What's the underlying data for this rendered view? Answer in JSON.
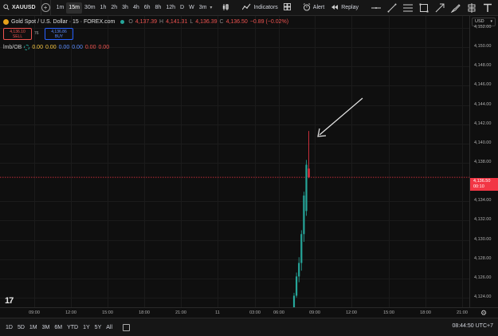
{
  "toolbar": {
    "symbol": "XAUUSD",
    "timeframes": [
      "1m",
      "15m",
      "30m",
      "1h",
      "2h",
      "3h",
      "4h",
      "6h",
      "8h",
      "12h",
      "D",
      "W",
      "3m"
    ],
    "active_timeframe": "15m",
    "indicators_label": "Indicators",
    "alert_label": "Alert",
    "replay_label": "Replay",
    "drawing_tools": [
      "horizontal-line-icon",
      "trend-line-icon",
      "fib-retracement-icon",
      "rectangle-icon",
      "arrow-tool-icon",
      "brush-icon",
      "long-position-icon",
      "text-icon",
      "measure-icon"
    ]
  },
  "legend": {
    "title": "Gold Spot / U.S. Dollar · 15 · FOREX.com",
    "o_label": "O",
    "o": "4,137.39",
    "h_label": "H",
    "h": "4,141.31",
    "l_label": "L",
    "l": "4,136.39",
    "c_label": "C",
    "c": "4,136.50",
    "change": "−0.89 (−0.02%)"
  },
  "trade": {
    "sell_price": "4,136.10",
    "sell_label": "SELL",
    "spread": "76",
    "buy_price": "4,136.86",
    "buy_label": "BUY"
  },
  "indicator": {
    "name": "lmb/OB",
    "values": [
      "0.00",
      "0.00",
      "0.00",
      "0.00",
      "0.00",
      "0.00"
    ],
    "value_colors": [
      "#f5c542",
      "#f5c542",
      "#5b8cff",
      "#5b8cff",
      "#ef5350",
      "#ef5350"
    ]
  },
  "price_axis": {
    "currency": "USD",
    "labels": [
      "4,152.00",
      "4,150.00",
      "4,148.00",
      "4,146.00",
      "4,144.00",
      "4,142.00",
      "4,140.00",
      "4,138.00",
      "4,134.00",
      "4,132.00",
      "4,130.00",
      "4,128.00",
      "4,126.00",
      "4,124.00"
    ],
    "current_price": "4,136.50",
    "countdown": "00:10"
  },
  "time_axis": {
    "labels": [
      "09:00",
      "12:00",
      "15:00",
      "18:00",
      "21:00",
      "11",
      "03:00",
      "06:00",
      "09:00",
      "12:00",
      "15:00",
      "18:00",
      "21:00"
    ]
  },
  "bottom_bar": {
    "ranges": [
      "1D",
      "5D",
      "1M",
      "3M",
      "6M",
      "YTD",
      "1Y",
      "5Y",
      "All"
    ],
    "clock": "08:44:50 UTC+7"
  },
  "colors": {
    "up": "#26a69a",
    "down": "#f23645",
    "background": "#0f0f0f",
    "price_line": "#f23645"
  },
  "chart_data": {
    "type": "candlestick",
    "timeframe": "15",
    "ylim": [
      4123,
      4153
    ],
    "candles": [
      {
        "o": 4123.0,
        "h": 4124.5,
        "l": 4122.8,
        "c": 4124.2,
        "dir": "up"
      },
      {
        "o": 4124.2,
        "h": 4126.6,
        "l": 4124.0,
        "c": 4126.2,
        "dir": "up"
      },
      {
        "o": 4126.2,
        "h": 4128.2,
        "l": 4125.6,
        "c": 4127.6,
        "dir": "up"
      },
      {
        "o": 4127.6,
        "h": 4131.0,
        "l": 4126.8,
        "c": 4130.6,
        "dir": "up"
      },
      {
        "o": 4130.6,
        "h": 4135.0,
        "l": 4129.8,
        "c": 4134.6,
        "dir": "up"
      },
      {
        "o": 4133.0,
        "h": 4138.3,
        "l": 4132.5,
        "c": 4137.8,
        "dir": "up"
      },
      {
        "o": 4137.4,
        "h": 4141.3,
        "l": 4136.4,
        "c": 4136.5,
        "dir": "down"
      }
    ]
  }
}
